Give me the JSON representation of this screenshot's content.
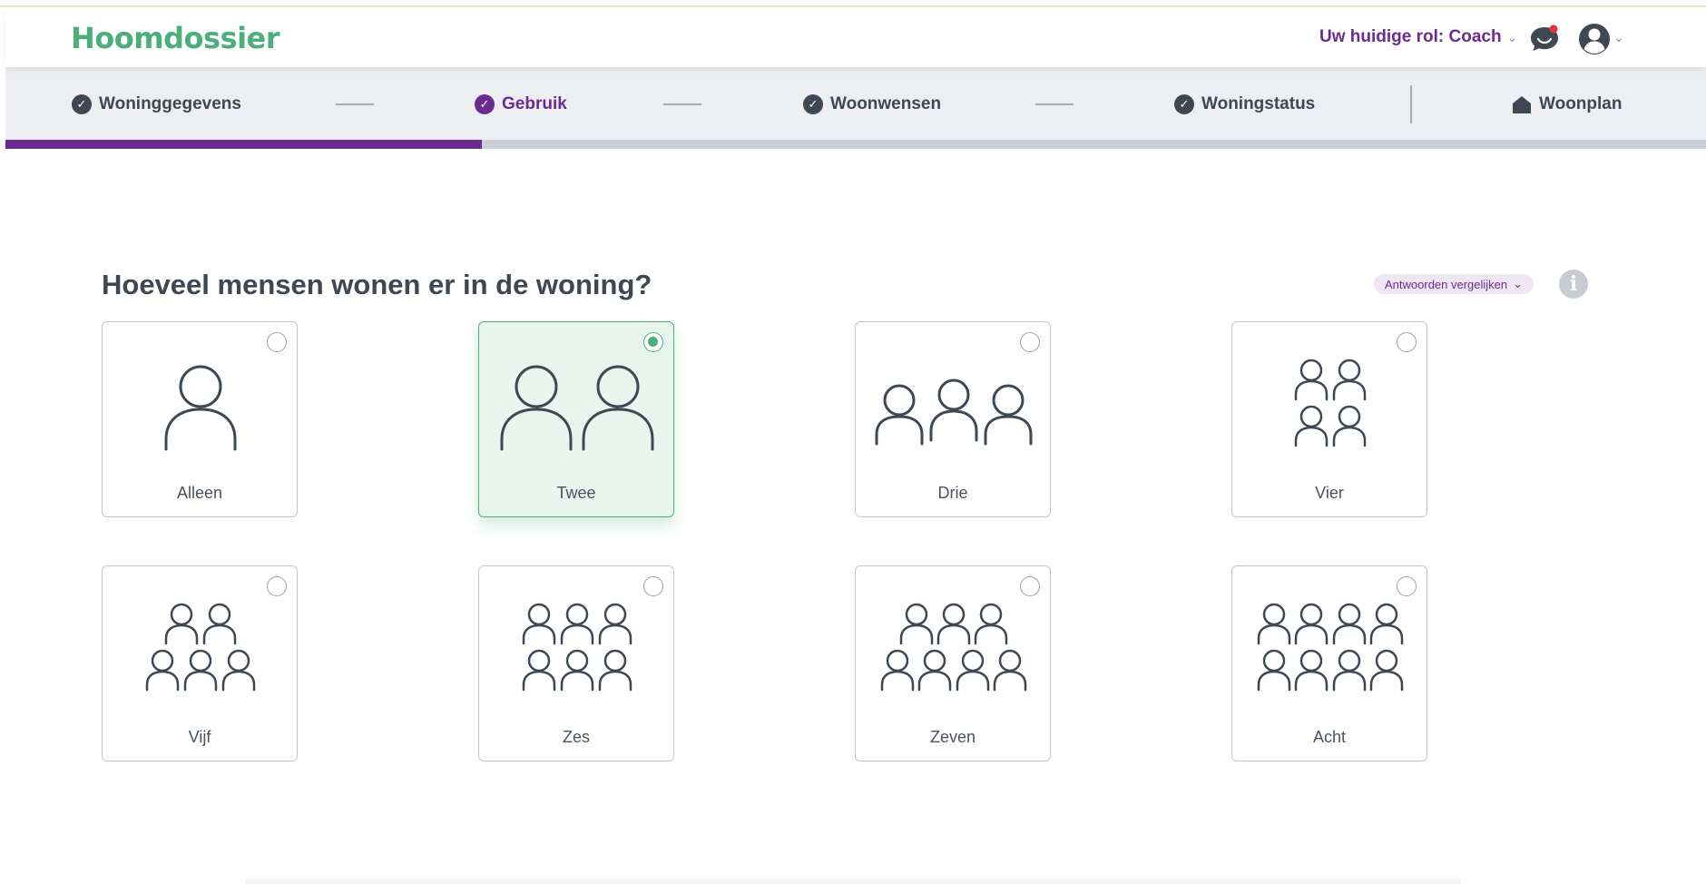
{
  "header": {
    "logo": "Hoomdossier",
    "role_label": "Uw huidige rol: Coach"
  },
  "steps": [
    {
      "label": "Woninggegevens",
      "state": "done"
    },
    {
      "label": "Gebruik",
      "state": "active"
    },
    {
      "label": "Woonwensen",
      "state": "done"
    },
    {
      "label": "Woningstatus",
      "state": "done"
    },
    {
      "label": "Woonplan",
      "state": "home"
    }
  ],
  "progress": {
    "fraction": 0.28
  },
  "question": {
    "title": "Hoeveel mensen wonen er in de woning?",
    "compare_label": "Antwoorden vergelijken"
  },
  "options": [
    {
      "label": "Alleen",
      "count": 1,
      "selected": false
    },
    {
      "label": "Twee",
      "count": 2,
      "selected": true
    },
    {
      "label": "Drie",
      "count": 3,
      "selected": false
    },
    {
      "label": "Vier",
      "count": 4,
      "selected": false
    },
    {
      "label": "Vijf",
      "count": 5,
      "selected": false
    },
    {
      "label": "Zes",
      "count": 6,
      "selected": false
    },
    {
      "label": "Zeven",
      "count": 7,
      "selected": false
    },
    {
      "label": "Acht",
      "count": 8,
      "selected": false
    }
  ],
  "colors": {
    "accent_purple": "#6a2c91",
    "brand_green": "#4cae7a",
    "notification_red": "#e0323a"
  }
}
